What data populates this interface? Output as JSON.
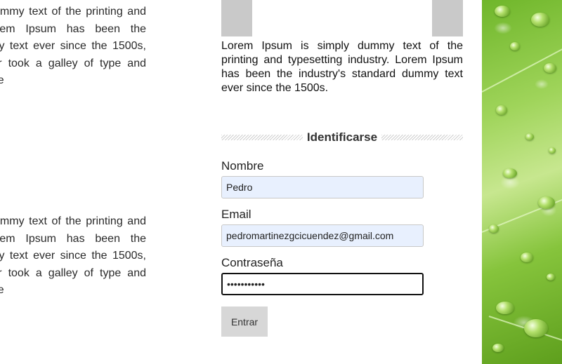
{
  "left": {
    "block_a": "Lorem Ipsum is simply dummy text of the printing and typesetting industry. Lorem Ipsum has been the industry's standard dummy text ever since the 1500s, when an unknown printer took a galley of type and scrambled it to make a type",
    "block_b": "Lorem Ipsum is simply dummy text of the printing and typesetting industry. Lorem Ipsum has been the industry's standard dummy text ever since the 1500s, when an unknown printer took a galley of type and scrambled it to make a type"
  },
  "intro_text": "Lorem Ipsum is simply dummy text of the printing and typesetting industry. Lorem Ipsum has been the industry's standard dummy text ever since the 1500s.",
  "login": {
    "title": "Identificarse",
    "nombre_label": "Nombre",
    "nombre_value": "Pedro",
    "email_label": "Email",
    "email_value": "pedromartinezgcicuendez@gmail.com",
    "password_label": "Contraseña",
    "password_value": "•••••••••••",
    "submit_label": "Entrar"
  },
  "colors": {
    "accent": "#c9c9c9",
    "autofill_bg": "#e8f0fe",
    "button_bg": "#d7d7d7"
  }
}
